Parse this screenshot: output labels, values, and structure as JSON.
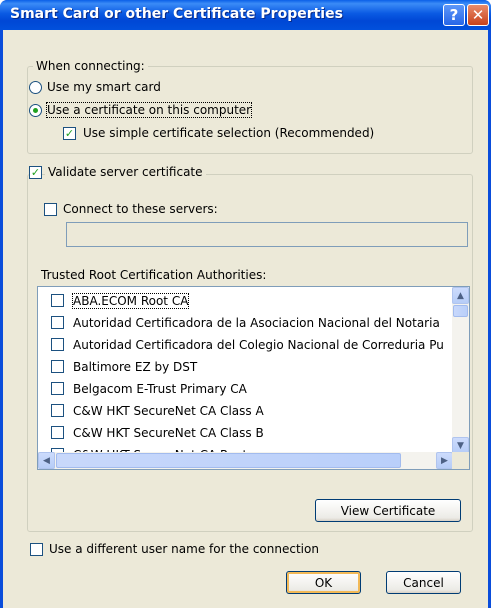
{
  "window": {
    "title": "Smart Card or other Certificate Properties",
    "help_glyph": "?",
    "close_glyph": "✕"
  },
  "when_connecting": {
    "group_label": "When connecting:",
    "use_smart_card": "Use my smart card",
    "use_certificate": "Use a certificate on this computer",
    "simple_selection": "Use simple certificate selection (Recommended)",
    "selected_option": "Use a certificate on this computer",
    "simple_selection_checked": true
  },
  "validate": {
    "label": "Validate server certificate",
    "checked": true,
    "connect_to_servers": "Connect to these servers:",
    "connect_checked": false,
    "servers_value": ""
  },
  "trusted_root": {
    "label": "Trusted Root Certification Authorities:",
    "items": [
      {
        "label": "ABA.ECOM Root CA",
        "checked": false
      },
      {
        "label": "Autoridad Certificadora de la Asociacion Nacional del Notaria",
        "checked": false
      },
      {
        "label": "Autoridad Certificadora del Colegio Nacional de Correduria Pu",
        "checked": false
      },
      {
        "label": "Baltimore EZ by DST",
        "checked": false
      },
      {
        "label": "Belgacom E-Trust Primary CA",
        "checked": false
      },
      {
        "label": "C&W HKT SecureNet CA Class A",
        "checked": false
      },
      {
        "label": "C&W HKT SecureNet CA Class B",
        "checked": false
      },
      {
        "label": "C&W HKT SecureNet CA Root",
        "checked": false
      }
    ],
    "view_certificate": "View Certificate"
  },
  "different_user": {
    "label": "Use a different user name for the connection",
    "checked": false
  },
  "buttons": {
    "ok": "OK",
    "cancel": "Cancel"
  },
  "colors": {
    "titlebar": "#0a5ae3",
    "dialog_bg": "#ece9d8",
    "check_mark": "#21a121",
    "default_button_glow": "#f2b957"
  }
}
